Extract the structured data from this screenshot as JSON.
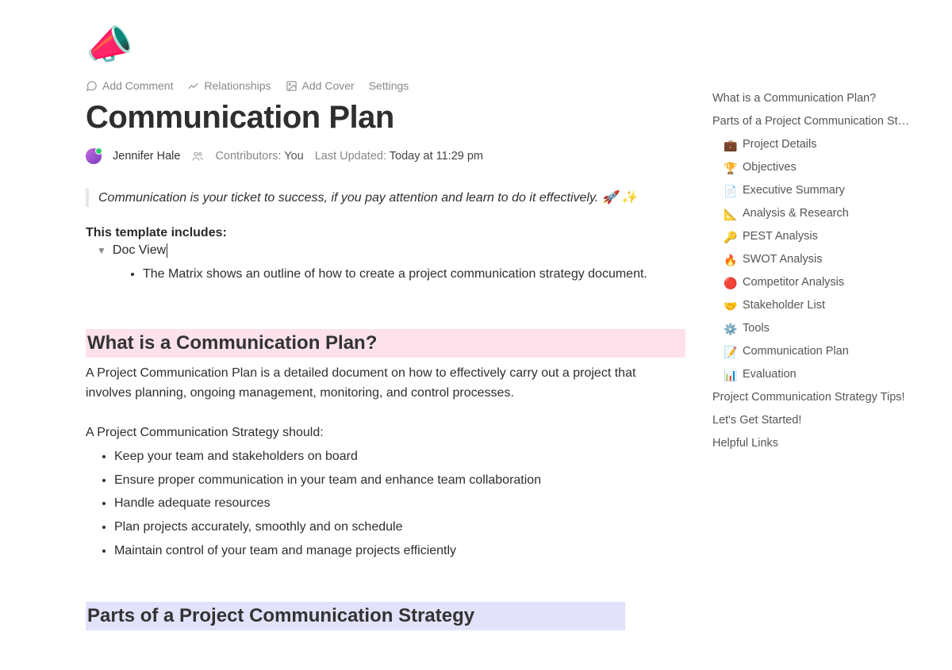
{
  "icon": "📣",
  "toolbar": {
    "add_comment": "Add Comment",
    "relationships": "Relationships",
    "add_cover": "Add Cover",
    "settings": "Settings"
  },
  "title": "Communication Plan",
  "meta": {
    "author": "Jennifer Hale",
    "contributors_label": "Contributors:",
    "contributors_value": "You",
    "updated_label": "Last Updated:",
    "updated_value": "Today at 11:29 pm"
  },
  "quote": "Communication is your ticket to success, if you pay attention and learn to do it effectively. 🚀 ✨",
  "template_includes_label": "This template includes:",
  "doc_view_label": "Doc View",
  "matrix_bullet": "The Matrix shows an outline of how to create a project communication strategy document.",
  "section1": {
    "heading": "What is a Communication Plan?",
    "para": "A Project Communication Plan is a detailed document on how to effectively carry out a project that involves planning, ongoing management, monitoring, and control processes.",
    "should_label": "A Project Communication Strategy should:",
    "bullets": [
      "Keep your team and stakeholders on board",
      "Ensure proper communication in your team and enhance team collaboration",
      "Handle adequate resources",
      "Plan projects accurately, smoothly and on schedule",
      "Maintain control of your team and manage projects efficiently"
    ]
  },
  "section2_heading": "Parts of a Project Communication Strategy",
  "outline": {
    "top": [
      "What is a Communication Plan?",
      "Parts of a Project Communication St…"
    ],
    "subs": [
      {
        "emoji": "💼",
        "label": "Project Details"
      },
      {
        "emoji": "🏆",
        "label": "Objectives"
      },
      {
        "emoji": "📄",
        "label": "Executive Summary"
      },
      {
        "emoji": "📐",
        "label": "Analysis & Research"
      },
      {
        "emoji": "🔑",
        "label": "PEST Analysis"
      },
      {
        "emoji": "🔥",
        "label": "SWOT Analysis"
      },
      {
        "emoji": "🔴",
        "label": "Competitor Analysis"
      },
      {
        "emoji": "🤝",
        "label": "Stakeholder List"
      },
      {
        "emoji": "⚙️",
        "label": "Tools"
      },
      {
        "emoji": "📝",
        "label": "Communication Plan"
      },
      {
        "emoji": "📊",
        "label": "Evaluation"
      }
    ],
    "bottom": [
      "Project Communication Strategy Tips!",
      "Let's Get Started!",
      "Helpful Links"
    ]
  }
}
